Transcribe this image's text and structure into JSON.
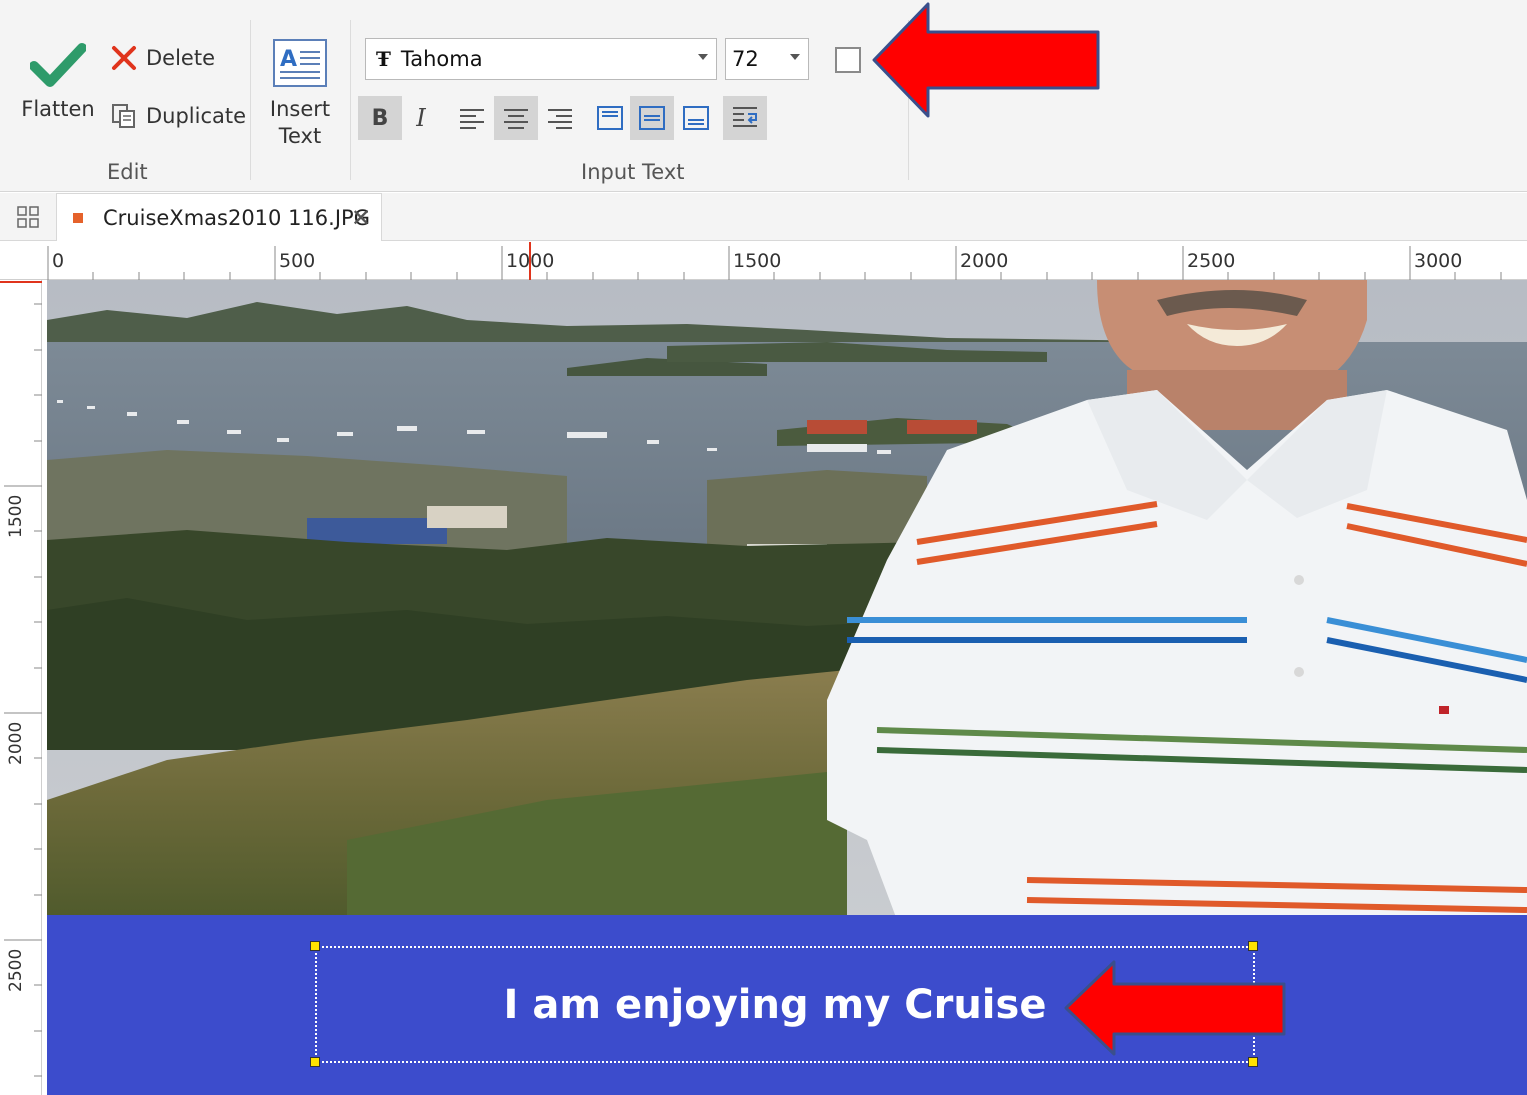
{
  "ribbon": {
    "edit_group": {
      "label": "Edit",
      "flatten": "Flatten",
      "delete": "Delete",
      "duplicate": "Duplicate",
      "insert_text_line1": "Insert",
      "insert_text_line2": "Text"
    },
    "input_text_group": {
      "label": "Input Text",
      "font_family": "Tahoma",
      "font_size": "72",
      "bold": "B",
      "italic": "I"
    }
  },
  "tabs": [
    {
      "name": "CruiseXmas2010 116.JPG"
    }
  ],
  "ruler": {
    "horizontal": [
      "0",
      "500",
      "1000",
      "1500",
      "2000",
      "2500",
      "3000"
    ],
    "vertical": [
      "1500",
      "2000",
      "2500"
    ]
  },
  "canvas": {
    "text_box_caption": "I am enjoying my Cruise",
    "band_color": "#3c4ccc"
  },
  "annotations": {
    "arrow_color": "#ff0000"
  }
}
